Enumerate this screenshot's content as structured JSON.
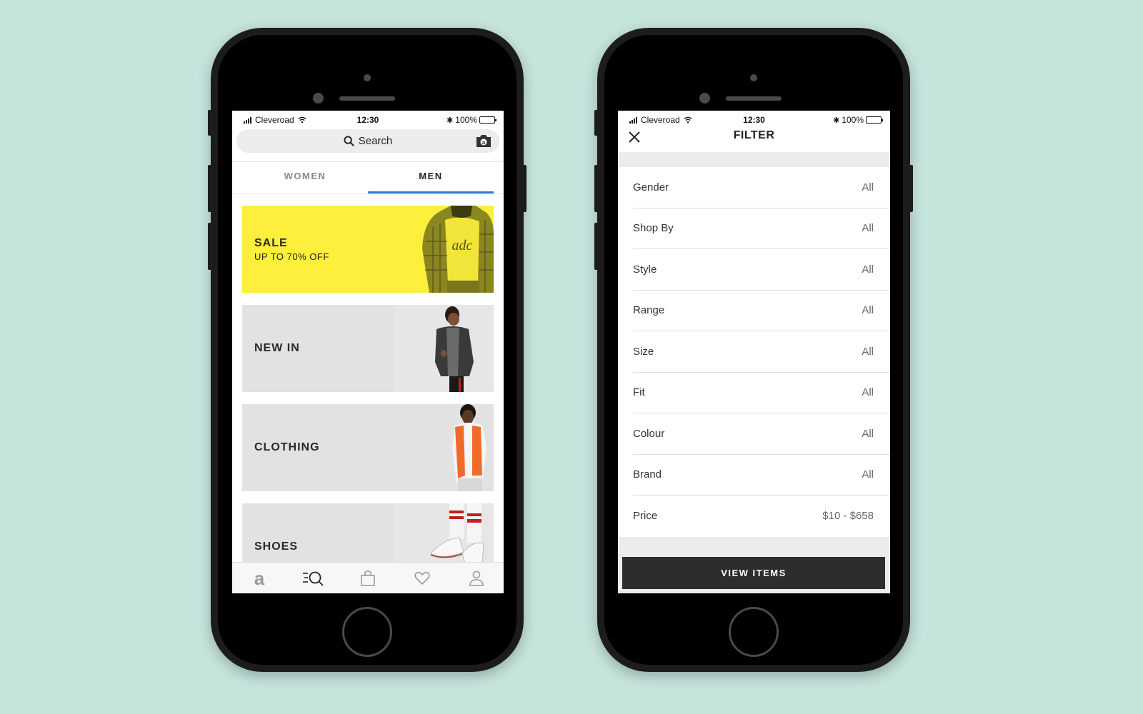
{
  "background_color": "#c5e4dc",
  "left_phone": {
    "status_bar": {
      "carrier": "Cleveroad",
      "time": "12:30",
      "battery_percent": "100%",
      "battery_level": 1.0
    },
    "search": {
      "placeholder": "Search",
      "icon": "search-icon",
      "camera_icon": "camera-search-icon"
    },
    "tabs": [
      {
        "label": "WOMEN",
        "active": false
      },
      {
        "label": "MEN",
        "active": true
      }
    ],
    "accent_color": "#2d7fc8",
    "banners": [
      {
        "title": "SALE",
        "subtitle": "UP TO 70% OFF",
        "bg": "#fdef3b",
        "image": "model-plaid-jacket"
      },
      {
        "title": "NEW IN",
        "bg": "#e2e2e2",
        "image": "model-denim-jacket"
      },
      {
        "title": "CLOTHING",
        "bg": "#e2e2e2",
        "image": "model-orange-vest"
      },
      {
        "title": "SHOES",
        "bg": "#e2e2e2",
        "image": "sneakers-striped-socks"
      }
    ],
    "bottom_nav": [
      {
        "name": "home",
        "icon": "asos-logo-icon"
      },
      {
        "name": "search",
        "icon": "search-list-icon",
        "active": true
      },
      {
        "name": "bag",
        "icon": "bag-icon"
      },
      {
        "name": "saved",
        "icon": "heart-icon"
      },
      {
        "name": "account",
        "icon": "user-icon"
      }
    ]
  },
  "right_phone": {
    "status_bar": {
      "carrier": "Cleveroad",
      "time": "12:30",
      "battery_percent": "100%",
      "battery_level": 1.0
    },
    "header": {
      "title": "FILTER",
      "close_icon": "close-icon"
    },
    "filters": [
      {
        "name": "Gender",
        "value": "All"
      },
      {
        "name": "Shop By",
        "value": "All"
      },
      {
        "name": "Style",
        "value": "All"
      },
      {
        "name": "Range",
        "value": "All"
      },
      {
        "name": "Size",
        "value": "All"
      },
      {
        "name": "Fit",
        "value": "All"
      },
      {
        "name": "Colour",
        "value": "All"
      },
      {
        "name": "Brand",
        "value": "All"
      },
      {
        "name": "Price",
        "value": "$10 - $658"
      }
    ],
    "view_button": "VIEW ITEMS",
    "button_color": "#2d2d2d"
  }
}
